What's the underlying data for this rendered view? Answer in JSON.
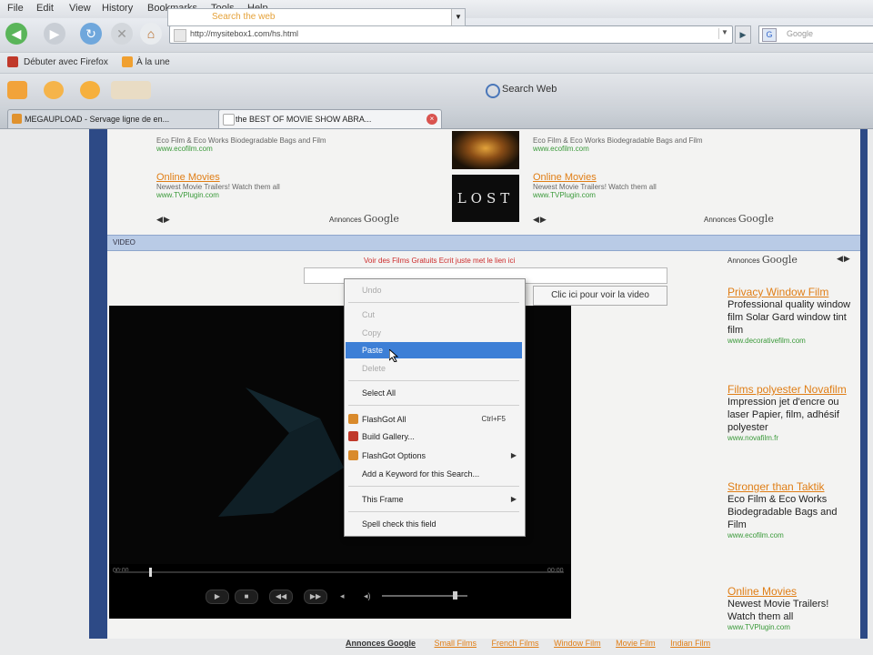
{
  "menubar": [
    "File",
    "Edit",
    "View",
    "History",
    "Bookmarks",
    "Tools",
    "Help"
  ],
  "navbar": {
    "url": "http://mysitebox1.com/hs.html",
    "search_placeholder": "Google"
  },
  "bookmarks": [
    "Débuter avec Firefox",
    "À la une"
  ],
  "toolbar2": {
    "search_placeholder": "Search the web",
    "search_button": "Search Web"
  },
  "tabs": [
    {
      "label": "MEGAUPLOAD - Servage ligne de en...",
      "active": false
    },
    {
      "label": "the BEST OF MOVIE SHOW ABRA...",
      "active": true
    }
  ],
  "top_ads": {
    "left": [
      {
        "text": "Eco Film & Eco Works Biodegradable Bags and Film",
        "url": "www.ecofilm.com"
      },
      {
        "title": "Online Movies",
        "text": "Newest Movie Trailers! Watch them all",
        "url": "www.TVPlugin.com"
      }
    ],
    "right": [
      {
        "text": "Eco Film & Eco Works Biodegradable Bags and Film",
        "url": "www.ecofilm.com"
      },
      {
        "title": "Online Movies",
        "text": "Newest Movie Trailers! Watch them all",
        "url": "www.TVPlugin.com"
      }
    ],
    "ads_by": "Annonces",
    "google": "Google",
    "lost_label": "LOST"
  },
  "video_section": {
    "header": "VIDEO",
    "message": "Voir des Films Gratuits Ecrit juste met le lien ici",
    "submit_label": "Clic ici pour voir la video",
    "time_left": "00:00",
    "time_right": "00:00"
  },
  "context_menu": {
    "items": [
      {
        "label": "Undo",
        "disabled": true
      },
      {
        "label": "Cut",
        "disabled": true
      },
      {
        "label": "Copy",
        "disabled": true
      },
      {
        "label": "Paste",
        "active": true
      },
      {
        "label": "Delete",
        "disabled": true
      },
      {
        "label": "Select All"
      },
      {
        "label": "FlashGot All",
        "shortcut": "Ctrl+F5"
      },
      {
        "label": "Build Gallery..."
      },
      {
        "label": "FlashGot Options"
      },
      {
        "label": "Add a Keyword for this Search..."
      },
      {
        "label": "This Frame"
      },
      {
        "label": "Spell check this field"
      }
    ]
  },
  "right_ads": {
    "ads_by": "Annonces",
    "google": "Google",
    "items": [
      {
        "title": "Privacy Window Film",
        "text": "Professional quality window film Solar Gard window tint film",
        "url": "www.decorativefilm.com"
      },
      {
        "title": "Films polyester Novafilm",
        "text": "Impression jet d'encre ou laser Papier, film, adhésif polyester",
        "url": "www.novafilm.fr"
      },
      {
        "title": "Stronger than Taktik",
        "text": "Eco Film & Eco Works Biodegradable Bags and Film",
        "url": "www.ecofilm.com"
      },
      {
        "title": "Online Movies",
        "text": "Newest Movie Trailers! Watch them all",
        "url": "www.TVPlugin.com"
      }
    ]
  },
  "bottom_links": {
    "ads_by": "Annonces Google",
    "links": [
      "Small Films",
      "French Films",
      "Window Film",
      "Movie Film",
      "Indian Film"
    ]
  }
}
